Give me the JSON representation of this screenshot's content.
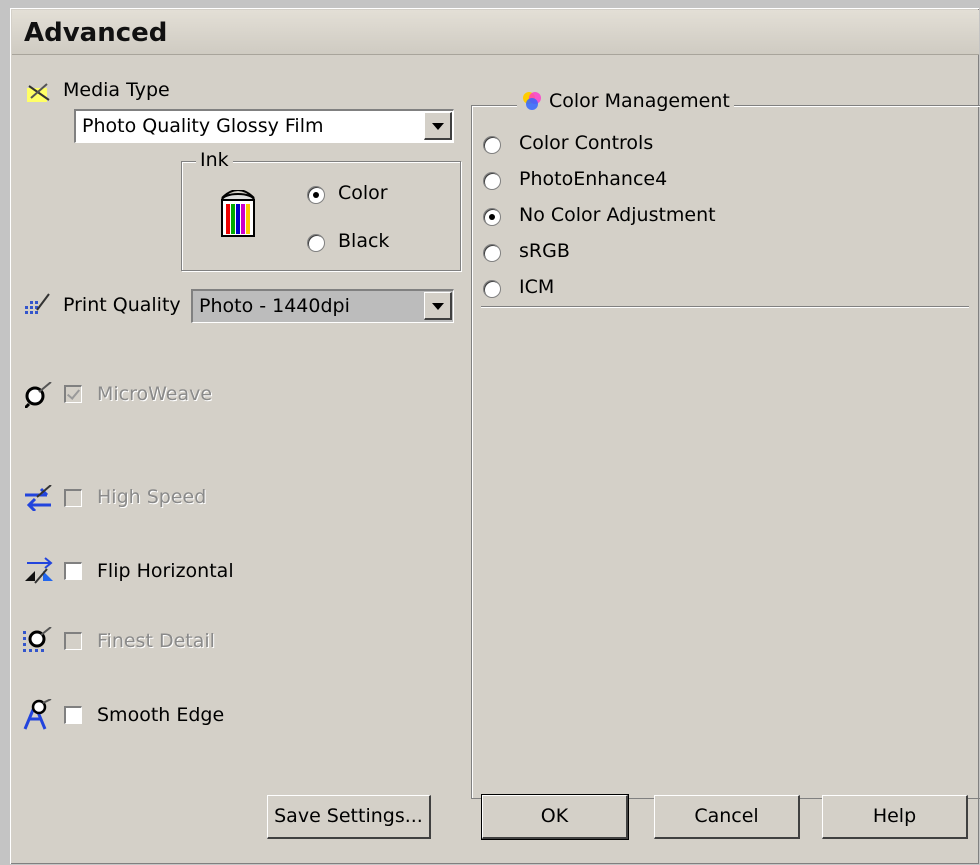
{
  "window": {
    "title": "Advanced"
  },
  "media_type": {
    "label": "Media Type",
    "value": "Photo Quality Glossy Film"
  },
  "ink": {
    "label": "Ink",
    "options": [
      {
        "label": "Color",
        "selected": true
      },
      {
        "label": "Black",
        "selected": false
      }
    ]
  },
  "print_quality": {
    "label": "Print Quality",
    "value": "Photo - 1440dpi"
  },
  "options": {
    "microweave": {
      "label": "MicroWeave",
      "checked": true,
      "enabled": false
    },
    "high_speed": {
      "label": "High Speed",
      "checked": false,
      "enabled": false
    },
    "flip_horizontal": {
      "label": "Flip Horizontal",
      "checked": false,
      "enabled": true
    },
    "finest_detail": {
      "label": "Finest Detail",
      "checked": false,
      "enabled": false
    },
    "smooth_edge": {
      "label": "Smooth Edge",
      "checked": false,
      "enabled": true
    }
  },
  "color_management": {
    "label": "Color Management",
    "options": [
      {
        "label": "Color Controls",
        "selected": false
      },
      {
        "label": "PhotoEnhance4",
        "selected": false
      },
      {
        "label": "No Color Adjustment",
        "selected": true
      },
      {
        "label": "sRGB",
        "selected": false
      },
      {
        "label": "ICM",
        "selected": false
      }
    ]
  },
  "buttons": {
    "save": "Save Settings...",
    "ok": "OK",
    "cancel": "Cancel",
    "help": "Help"
  },
  "icons": [
    "media-type-icon",
    "ink-bucket-icon",
    "print-quality-icon",
    "microweave-icon",
    "high-speed-icon",
    "flip-horizontal-icon",
    "finest-detail-icon",
    "smooth-edge-icon",
    "color-management-icon"
  ]
}
